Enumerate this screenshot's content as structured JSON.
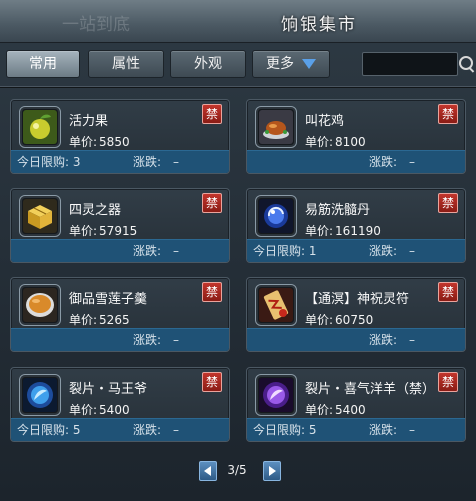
{
  "window": {
    "title": "饷银集市",
    "ghost_text": "一站到底"
  },
  "tabs": [
    {
      "label": "常用",
      "active": true
    },
    {
      "label": "属性",
      "active": false
    },
    {
      "label": "外观",
      "active": false
    },
    {
      "label": "更多",
      "active": false,
      "dropdown": true
    }
  ],
  "search": {
    "value": "",
    "placeholder": ""
  },
  "labels": {
    "price": "单价:",
    "daily_limit": "今日限购:",
    "change": "涨跌:",
    "change_value": "–",
    "ban": "禁"
  },
  "items": [
    {
      "name": "活力果",
      "price": "5850",
      "limit": "3",
      "icon": "fruit-icon"
    },
    {
      "name": "叫花鸡",
      "price": "8100",
      "limit": "",
      "icon": "roast-chicken-icon"
    },
    {
      "name": "四灵之器",
      "price": "57915",
      "limit": "",
      "icon": "golden-box-icon"
    },
    {
      "name": "易筋洗髓丹",
      "price": "161190",
      "limit": "1",
      "icon": "blue-orb-icon"
    },
    {
      "name": "御品雪莲子羹",
      "price": "5265",
      "limit": "",
      "icon": "soup-bowl-icon"
    },
    {
      "name": "【通溟】神祝灵符",
      "price": "60750",
      "limit": "",
      "icon": "talisman-icon"
    },
    {
      "name": "裂片・马王爷",
      "price": "5400",
      "limit": "5",
      "icon": "blue-shard-icon"
    },
    {
      "name": "裂片・喜气洋羊（禁）",
      "price": "5400",
      "limit": "5",
      "icon": "purple-shard-icon"
    }
  ],
  "pagination": {
    "text": "3/5",
    "current": 3,
    "total": 5
  }
}
